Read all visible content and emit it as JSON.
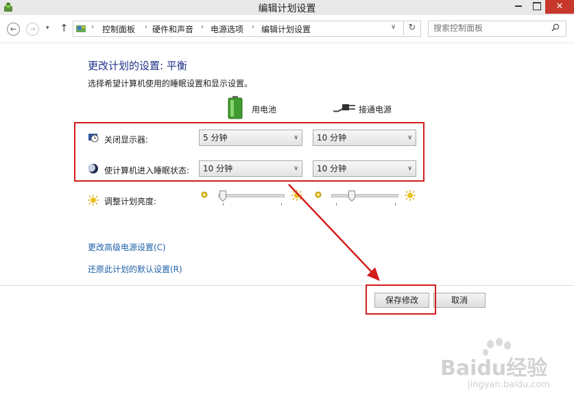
{
  "window": {
    "title": "编辑计划设置",
    "close_glyph": "✕"
  },
  "nav": {
    "back_glyph": "←",
    "forward_glyph": "→",
    "recent_glyph": "▾",
    "up_glyph": "↑",
    "breadcrumb": [
      "控制面板",
      "硬件和声音",
      "电源选项",
      "编辑计划设置"
    ],
    "breadcrumb_sep": "›",
    "address_dropdown_glyph": "∨",
    "refresh_glyph": "↻",
    "search_placeholder": "搜索控制面板"
  },
  "main": {
    "title": "更改计划的设置: 平衡",
    "subtitle": "选择希望计算机使用的睡眠设置和显示设置。",
    "columns": {
      "battery": "用电池",
      "plugged": "接通电源"
    },
    "settings": [
      {
        "label": "关闭显示器:",
        "icon": "monitor-clock-icon",
        "battery": "5 分钟",
        "plugged": "10 分钟"
      },
      {
        "label": "使计算机进入睡眠状态:",
        "icon": "moon-icon",
        "battery": "10 分钟",
        "plugged": "10 分钟"
      }
    ],
    "brightness": {
      "label": "调整计划亮度:",
      "battery_level": 0.0,
      "plugged_level": 0.27
    },
    "links": {
      "advanced": "更改高级电源设置(C)",
      "restore": "还原此计划的默认设置(R)"
    },
    "buttons": {
      "save": "保存修改",
      "cancel": "取消"
    },
    "dropdown_arrow": "∨"
  },
  "annotation": {
    "color": "#d21c1c"
  },
  "watermark": {
    "brand": "Baidu经验",
    "url": "jingyan.baidu.com"
  },
  "colors": {
    "title_blue": "#1e3287",
    "link_blue": "#1f5fa8"
  }
}
